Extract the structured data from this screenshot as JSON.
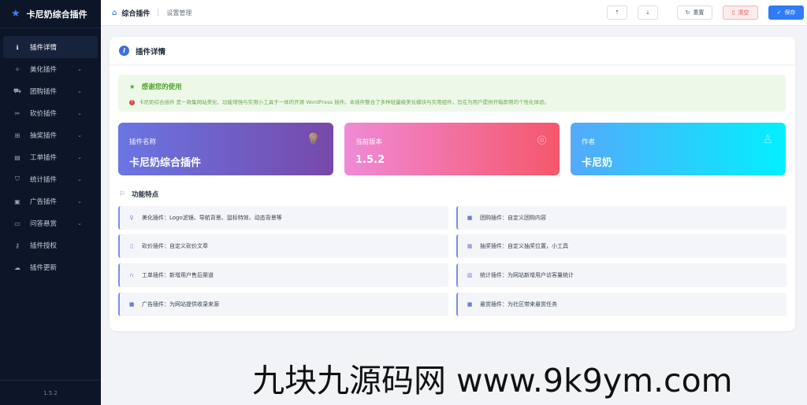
{
  "sidebar": {
    "title": "卡尼奶综合插件",
    "items": [
      {
        "label": "插件详情",
        "icon": "info-icon",
        "glyph": "ℹ",
        "expandable": false,
        "active": true
      },
      {
        "label": "美化插件",
        "icon": "magic-icon",
        "glyph": "✧",
        "expandable": true
      },
      {
        "label": "团购插件",
        "icon": "cart-icon",
        "glyph": "⛟",
        "expandable": true
      },
      {
        "label": "砍价插件",
        "icon": "scissors-icon",
        "glyph": "✂",
        "expandable": true
      },
      {
        "label": "抽奖插件",
        "icon": "gift-icon",
        "glyph": "⊞",
        "expandable": true
      },
      {
        "label": "工单插件",
        "icon": "ticket-icon",
        "glyph": "▤",
        "expandable": true
      },
      {
        "label": "统计插件",
        "icon": "stats-icon",
        "glyph": "⛉",
        "expandable": true
      },
      {
        "label": "广告插件",
        "icon": "image-icon",
        "glyph": "▣",
        "expandable": true
      },
      {
        "label": "问答悬赏",
        "icon": "chat-icon",
        "glyph": "▭",
        "expandable": true
      },
      {
        "label": "插件授权",
        "icon": "key-icon",
        "glyph": "⚷",
        "expandable": false
      },
      {
        "label": "插件更新",
        "icon": "cloud-icon",
        "glyph": "☁",
        "expandable": false
      }
    ],
    "version": "1.5.2"
  },
  "header": {
    "breadcrumb_main": "综合插件",
    "breadcrumb_sub": "设置管理",
    "reset_label": "重置",
    "clear_label": "清空",
    "save_label": "保存"
  },
  "card": {
    "title": "插件详情",
    "thanks_title": "感谢您的使用",
    "thanks_text": "卡尼奶综合插件 是一款集网站美化、功能增强与实用小工具于一体的开源 WordPress 插件。本插件整合了多种轻量级美化模块与实用组件，旨在为用户提供开箱即用的个性化体验。",
    "stats": [
      {
        "label": "插件名称",
        "value": "卡尼奶综合插件",
        "icon": "bulb-icon"
      },
      {
        "label": "当前版本",
        "value": "1.5.2",
        "icon": "medal-icon"
      },
      {
        "label": "作者",
        "value": "卡尼奶",
        "icon": "user-icon"
      }
    ],
    "features_title": "功能特点",
    "features": [
      {
        "text": "美化插件：Logo滤镜、导航背景、鼠标特效、动态背景等",
        "icon": "bulb-small-icon",
        "glyph": "♀"
      },
      {
        "text": "团购插件：自定义团购内容",
        "icon": "cart-small-icon",
        "glyph": "■"
      },
      {
        "text": "砍价插件：自定义砍价文章",
        "icon": "doc-small-icon",
        "glyph": "▯"
      },
      {
        "text": "抽奖插件：自定义抽奖位置，小工具",
        "icon": "calendar-small-icon",
        "glyph": "▦"
      },
      {
        "text": "工单插件：新增用户售后渠道",
        "icon": "headset-small-icon",
        "glyph": "∩"
      },
      {
        "text": "统计插件：为网站新增用户访客量统计",
        "icon": "chart-small-icon",
        "glyph": "▥"
      },
      {
        "text": "广告插件：为网站提供收录来源",
        "icon": "ad-small-icon",
        "glyph": "■"
      },
      {
        "text": "悬赏插件：为社区带来悬赏任务",
        "icon": "reward-small-icon",
        "glyph": "■"
      }
    ]
  },
  "watermark": "九块九源码网 www.9k9ym.com",
  "colors": {
    "sidebar_bg": "#0d1628",
    "accent": "#2f7cf6",
    "success": "#4fa72f",
    "danger": "#e25555"
  }
}
